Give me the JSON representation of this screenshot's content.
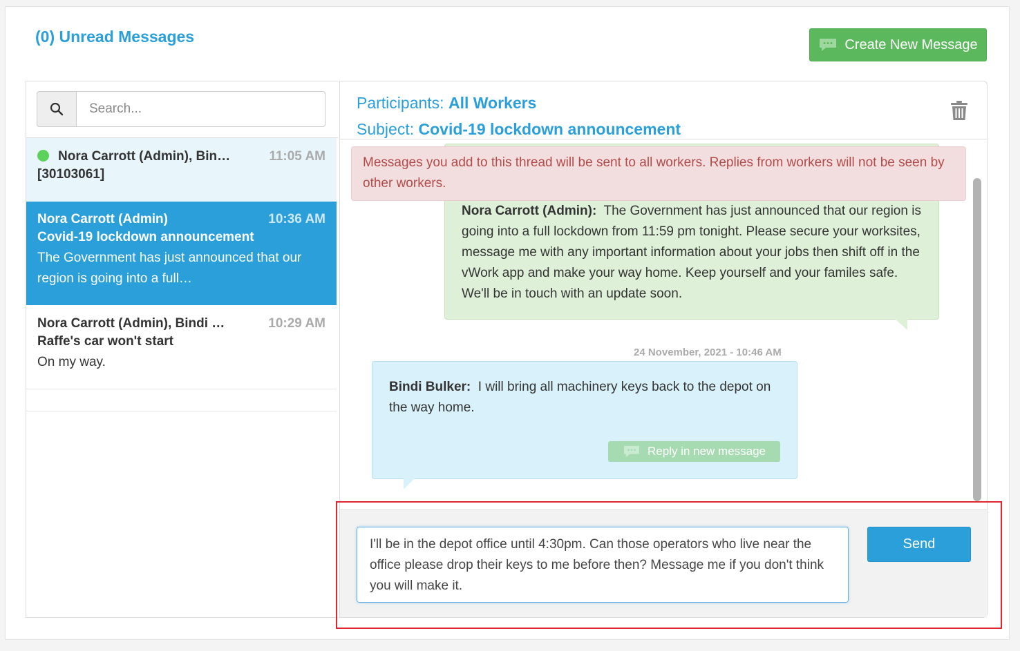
{
  "header": {
    "unread_label": "(0) Unread Messages",
    "create_button_label": "Create New Message"
  },
  "search": {
    "placeholder": "Search..."
  },
  "threads": [
    {
      "name": "Nora Carrott (Admin), Bin…",
      "time": "11:05 AM",
      "line1": "[30103061]",
      "online": true,
      "state": "unread"
    },
    {
      "name": "Nora Carrott (Admin)",
      "time": "10:36 AM",
      "line1": "Covid-19 lockdown announcement",
      "line2": "The Government has just announced that our",
      "line3": "region is going into a full…",
      "state": "selected"
    },
    {
      "name": "Nora Carrott (Admin), Bindi …",
      "time": "10:29 AM",
      "line1": "Raffe's car won't start",
      "line2": "On my way.",
      "state": "normal"
    }
  ],
  "conversation": {
    "participants_label": "Participants:",
    "participants_value": "All Workers",
    "subject_label": "Subject:",
    "subject_value": "Covid-19 lockdown announcement",
    "alert": "Messages you add to this thread will be sent to all workers. Replies from workers will not be seen by other workers.",
    "messages": [
      {
        "author": "Nora Carrott (Admin):",
        "text": "The Government has just announced that our region is going into a full lockdown from 11:59 pm tonight. Please secure your worksites, message me with any important information about your jobs then shift off in the vWork app and make your way home. Keep yourself and your familes safe. We'll be in touch with an update soon."
      },
      {
        "timestamp": "24 November, 2021 - 10:46 AM",
        "author": "Bindi Bulker:",
        "text": "I will bring all machinery keys back to the depot on the way home.",
        "reply_label": "Reply in new message"
      }
    ]
  },
  "composer": {
    "value": "I'll be in the depot office until 4:30pm. Can those operators who live near the office please drop their keys to me before then? Message me if you don't think you will make it.",
    "send_label": "Send"
  },
  "colors": {
    "accent": "#2a9fd9",
    "success": "#5cb85c",
    "alert_bg": "#f2dede",
    "highlight": "#e0262e"
  }
}
